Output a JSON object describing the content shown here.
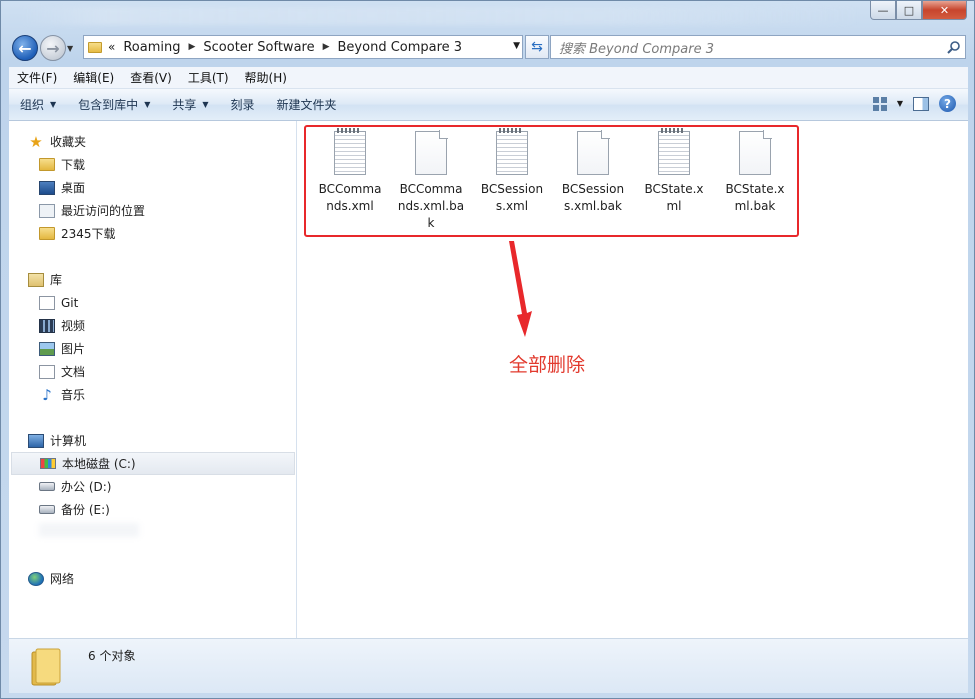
{
  "window": {
    "caption_buttons": {
      "minimize": "—",
      "maximize": "□",
      "close": "✕"
    }
  },
  "nav": {
    "back_icon": "back-arrow-icon",
    "forward_icon": "forward-arrow-icon",
    "breadcrumb_overflow": "«",
    "breadcrumb": [
      "Roaming",
      "Scooter Software",
      "Beyond Compare 3"
    ],
    "search_placeholder": "搜索 Beyond Compare 3"
  },
  "menu": [
    "文件(F)",
    "编辑(E)",
    "查看(V)",
    "工具(T)",
    "帮助(H)"
  ],
  "commands": [
    {
      "label": "组织",
      "dropdown": true
    },
    {
      "label": "包含到库中",
      "dropdown": true
    },
    {
      "label": "共享",
      "dropdown": true
    },
    {
      "label": "刻录",
      "dropdown": false
    },
    {
      "label": "新建文件夹",
      "dropdown": false
    }
  ],
  "sidebar": {
    "favorites": {
      "label": "收藏夹",
      "items": [
        "下载",
        "桌面",
        "最近访问的位置",
        "2345下载"
      ]
    },
    "libraries": {
      "label": "库",
      "items": [
        "Git",
        "视频",
        "图片",
        "文档",
        "音乐"
      ]
    },
    "computer": {
      "label": "计算机",
      "items": [
        "本地磁盘 (C:)",
        "办公 (D:)",
        "备份 (E:)"
      ]
    },
    "network": {
      "label": "网络"
    }
  },
  "files": [
    {
      "name": "BCCommands.xml",
      "line1": "BCComma",
      "line2": "nds.xml",
      "line3": "",
      "icon": "text-document-icon"
    },
    {
      "name": "BCCommands.xml.bak",
      "line1": "BCComma",
      "line2": "nds.xml.ba",
      "line3": "k",
      "icon": "blank-document-icon"
    },
    {
      "name": "BCSessions.xml",
      "line1": "BCSession",
      "line2": "s.xml",
      "line3": "",
      "icon": "text-document-icon"
    },
    {
      "name": "BCSessions.xml.bak",
      "line1": "BCSession",
      "line2": "s.xml.bak",
      "line3": "",
      "icon": "blank-document-icon"
    },
    {
      "name": "BCState.xml",
      "line1": "BCState.x",
      "line2": "ml",
      "line3": "",
      "icon": "text-document-icon"
    },
    {
      "name": "BCState.xml.bak",
      "line1": "BCState.x",
      "line2": "ml.bak",
      "line3": "",
      "icon": "blank-document-icon"
    }
  ],
  "annotation": {
    "text": "全部删除",
    "color": "#e23a2e"
  },
  "status": {
    "count_text": "6 个对象"
  },
  "colors": {
    "highlight_box": "#e8282b",
    "accent": "#1f5fb8"
  }
}
